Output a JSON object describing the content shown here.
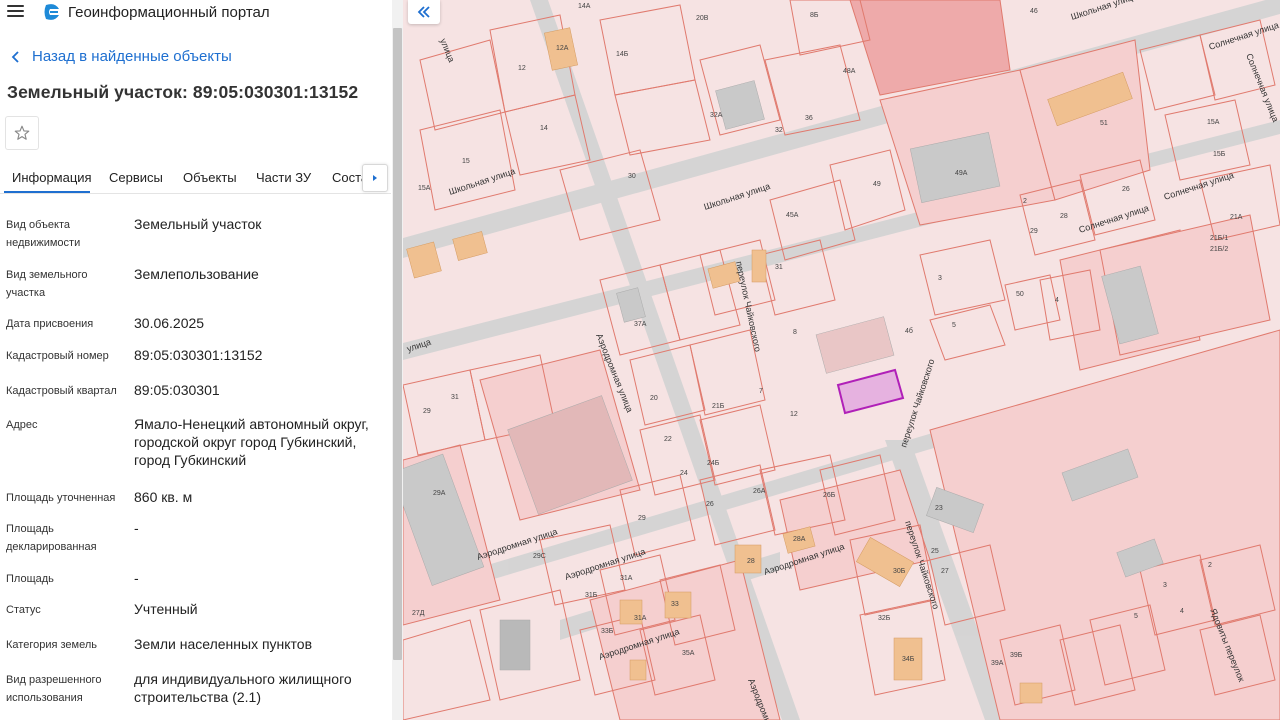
{
  "app": {
    "title": "Геоинформационный портал"
  },
  "nav": {
    "back_label": "Назад в найденные объекты"
  },
  "object": {
    "title": "Земельный участок: 89:05:030301:13152"
  },
  "tabs": [
    {
      "label": "Информация"
    },
    {
      "label": "Сервисы"
    },
    {
      "label": "Объекты"
    },
    {
      "label": "Части ЗУ"
    },
    {
      "label": "Соста"
    }
  ],
  "fields": [
    {
      "label": "Вид объекта\nнедвижимости",
      "value": "Земельный участок"
    },
    {
      "label": "Вид земельного\nучастка",
      "value": "Землепользование"
    },
    {
      "label": "Дата присвоения",
      "value": "30.06.2025"
    },
    {
      "label": "Кадастровый номер",
      "value": "89:05:030301:13152"
    },
    {
      "label": "Кадастровый квартал",
      "value": "89:05:030301"
    },
    {
      "label": "Адрес",
      "value": "Ямало-Ненецкий автономный округ,\nгородской округ город Губкинский,\nгород Губкинский"
    },
    {
      "label": "Площадь уточненная",
      "value": "860 кв. м"
    },
    {
      "label": "Площадь\nдекларированная",
      "value": "-"
    },
    {
      "label": "Площадь",
      "value": "-"
    },
    {
      "label": "Статус",
      "value": "Учтенный"
    },
    {
      "label": "Категория земель",
      "value": "Земли населенных пунктов"
    },
    {
      "label": "Вид разрешенного\nиспользования",
      "value": "для индивидуального жилищного\nстроительства (2.1)"
    }
  ],
  "map": {
    "streets": [
      "Школьная улица",
      "Аэродромная улица",
      "переулок Чайковского",
      "Солнечная улица",
      "Ядовиты переулок"
    ],
    "parcel_labels": [
      "14А",
      "12А",
      "14Б",
      "20В",
      "8Б",
      "12",
      "14",
      "15",
      "15А",
      "30",
      "32",
      "32А",
      "36",
      "48А",
      "49А",
      "51",
      "15А",
      "15Б",
      "45А",
      "49",
      "26",
      "28",
      "29",
      "21А",
      "21Б/1",
      "21Б/2",
      "3",
      "4",
      "5",
      "50",
      "37А",
      "20",
      "22",
      "24",
      "24Б",
      "21Б",
      "29",
      "31",
      "29А",
      "29С",
      "26",
      "26А",
      "26Б",
      "28",
      "28А",
      "31А",
      "31Б",
      "31А",
      "33",
      "33Б",
      "35А",
      "34Б",
      "23",
      "25",
      "27",
      "2",
      "3",
      "4",
      "5",
      "39А",
      "39Б",
      "46",
      "12",
      "31",
      "8",
      "7",
      "21Б",
      "5",
      "2",
      "4"
    ],
    "highlight_color": "#c030c0",
    "fill_color": "#f5d7d7",
    "line_color": "#e07a6e"
  }
}
